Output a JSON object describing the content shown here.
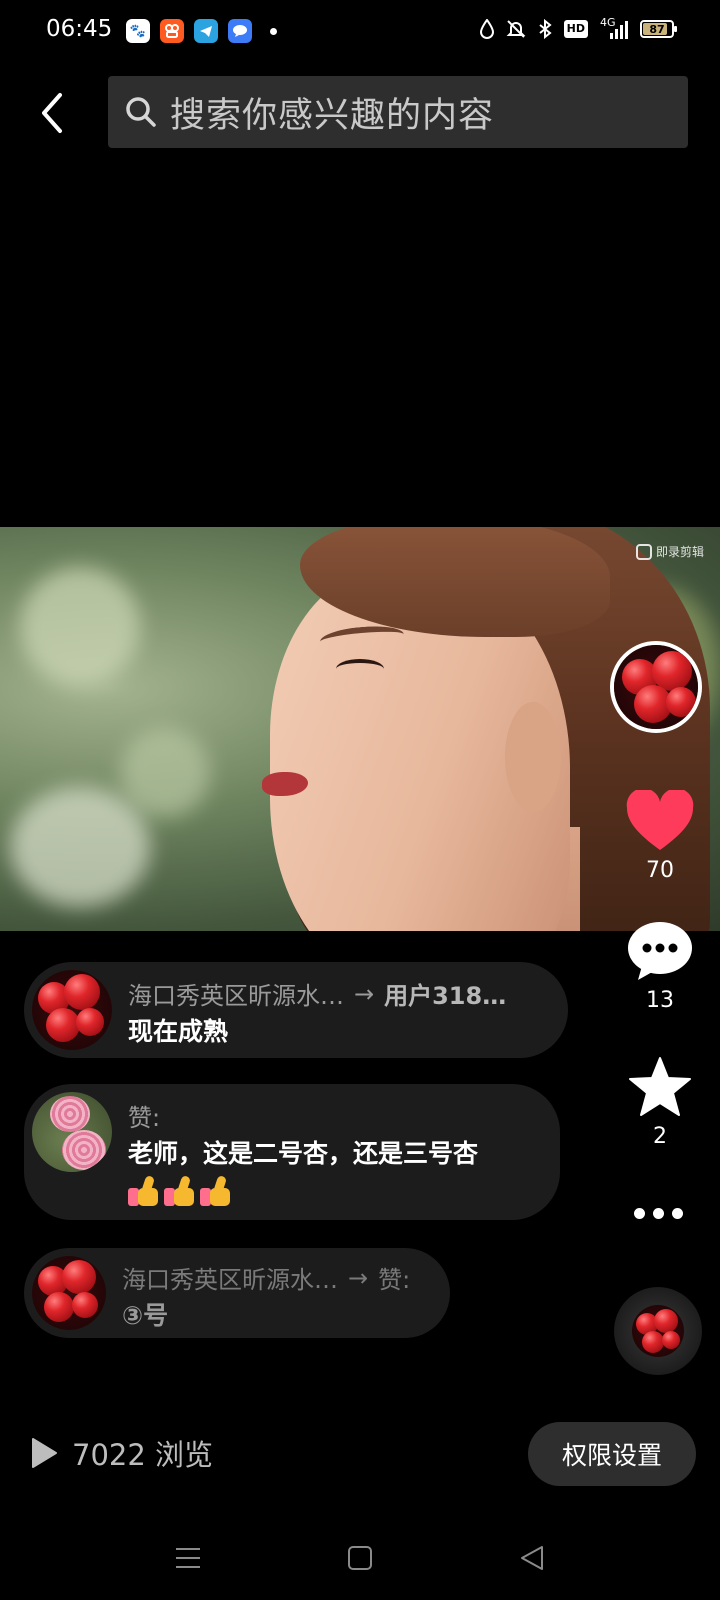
{
  "status_bar": {
    "time": "06:45",
    "network": "4G",
    "hd_label": "HD",
    "battery": "87",
    "battery_level": 0.87,
    "app_icons": [
      "baidu-app-icon",
      "kuaishou-app-icon",
      "telegram-app-icon",
      "message-bubble-app-icon"
    ]
  },
  "search": {
    "placeholder": "搜索你感兴趣的内容"
  },
  "video": {
    "watermark": "即录剪辑"
  },
  "actions": {
    "likes": "70",
    "comments": "13",
    "favorites": "2",
    "like_color": "#ff3b5c"
  },
  "comments": [
    {
      "author": "海口秀英区昕源水…",
      "reply_to": "用户318…",
      "text": "现在成熟"
    },
    {
      "author": "赞:",
      "text": "老师，这是二号杏，还是三号杏",
      "emoji": [
        "thumbs-up",
        "thumbs-up",
        "thumbs-up"
      ]
    },
    {
      "author": "海口秀英区昕源水…",
      "reply_to": "赞:",
      "text": "③号"
    }
  ],
  "footer": {
    "views": "7022 浏览",
    "permission_button": "权限设置"
  }
}
